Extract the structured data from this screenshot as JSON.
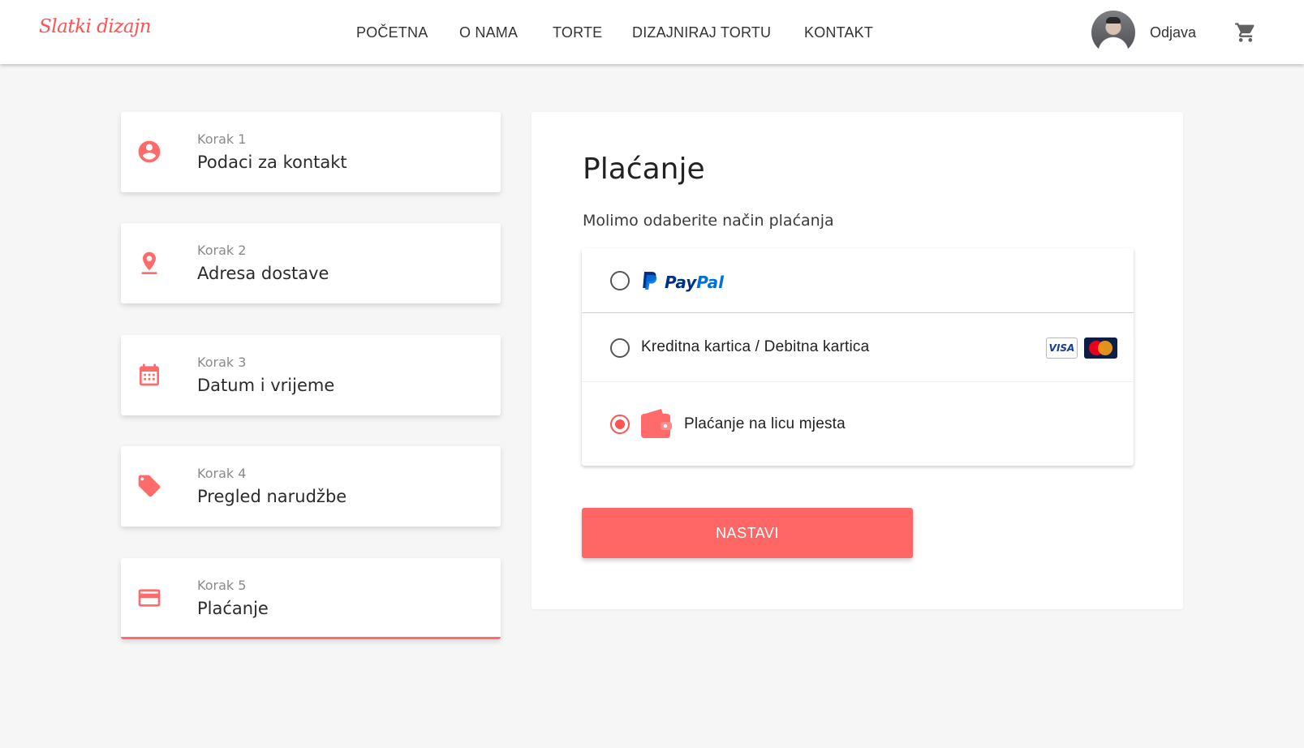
{
  "brand": {
    "logo_text": "Slatki dizajn",
    "accent": "#ff5252"
  },
  "nav": {
    "items": [
      "POČETNA",
      "O NAMA",
      "TORTE",
      "DIZAJNIRAJ TORTU",
      "KONTAKT"
    ],
    "logout_label": "Odjava",
    "cart_icon": "shopping-cart-icon"
  },
  "steps": [
    {
      "number": "Korak 1",
      "title": "Podaci za kontakt",
      "icon": "account-circle-icon"
    },
    {
      "number": "Korak 2",
      "title": "Adresa dostave",
      "icon": "location-pin-icon"
    },
    {
      "number": "Korak 3",
      "title": "Datum i vrijeme",
      "icon": "calendar-icon"
    },
    {
      "number": "Korak 4",
      "title": "Pregled narudžbe",
      "icon": "tag-icon"
    },
    {
      "number": "Korak 5",
      "title": "Plaćanje",
      "icon": "credit-card-icon",
      "active": true
    }
  ],
  "payment": {
    "title": "Plaćanje",
    "subtitle": "Molimo odaberite način plaćanja",
    "options": [
      {
        "brand_pay": "Pay",
        "brand_pal": "Pal",
        "selected": false
      },
      {
        "label": "Kreditna kartica / Debitna kartica",
        "card_badge": "VISA",
        "selected": false
      },
      {
        "label": "Plaćanje na licu mjesta",
        "selected": true
      }
    ],
    "submit_label": "NASTAVI"
  }
}
